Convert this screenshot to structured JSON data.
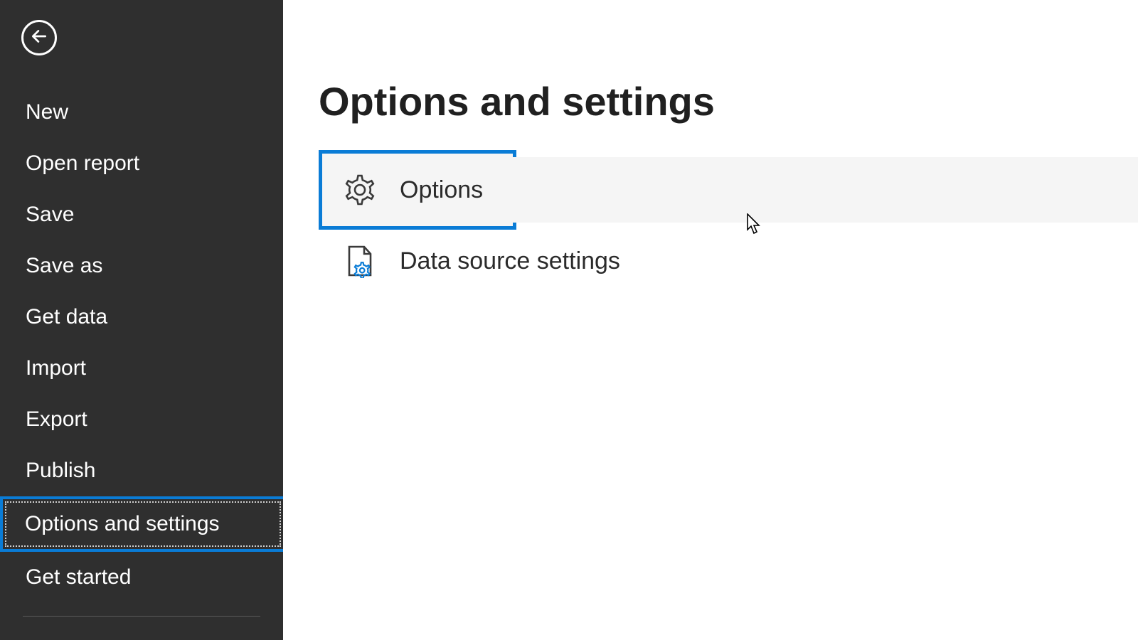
{
  "sidebar": {
    "items": [
      {
        "label": "New"
      },
      {
        "label": "Open report"
      },
      {
        "label": "Save"
      },
      {
        "label": "Save as"
      },
      {
        "label": "Get data"
      },
      {
        "label": "Import"
      },
      {
        "label": "Export"
      },
      {
        "label": "Publish"
      },
      {
        "label": "Options and settings"
      },
      {
        "label": "Get started"
      }
    ]
  },
  "content": {
    "title": "Options and settings",
    "options_label": "Options",
    "data_source_label": "Data source settings"
  },
  "colors": {
    "highlight": "#0a7cd6",
    "sidebar_bg": "#2f2f2f"
  }
}
